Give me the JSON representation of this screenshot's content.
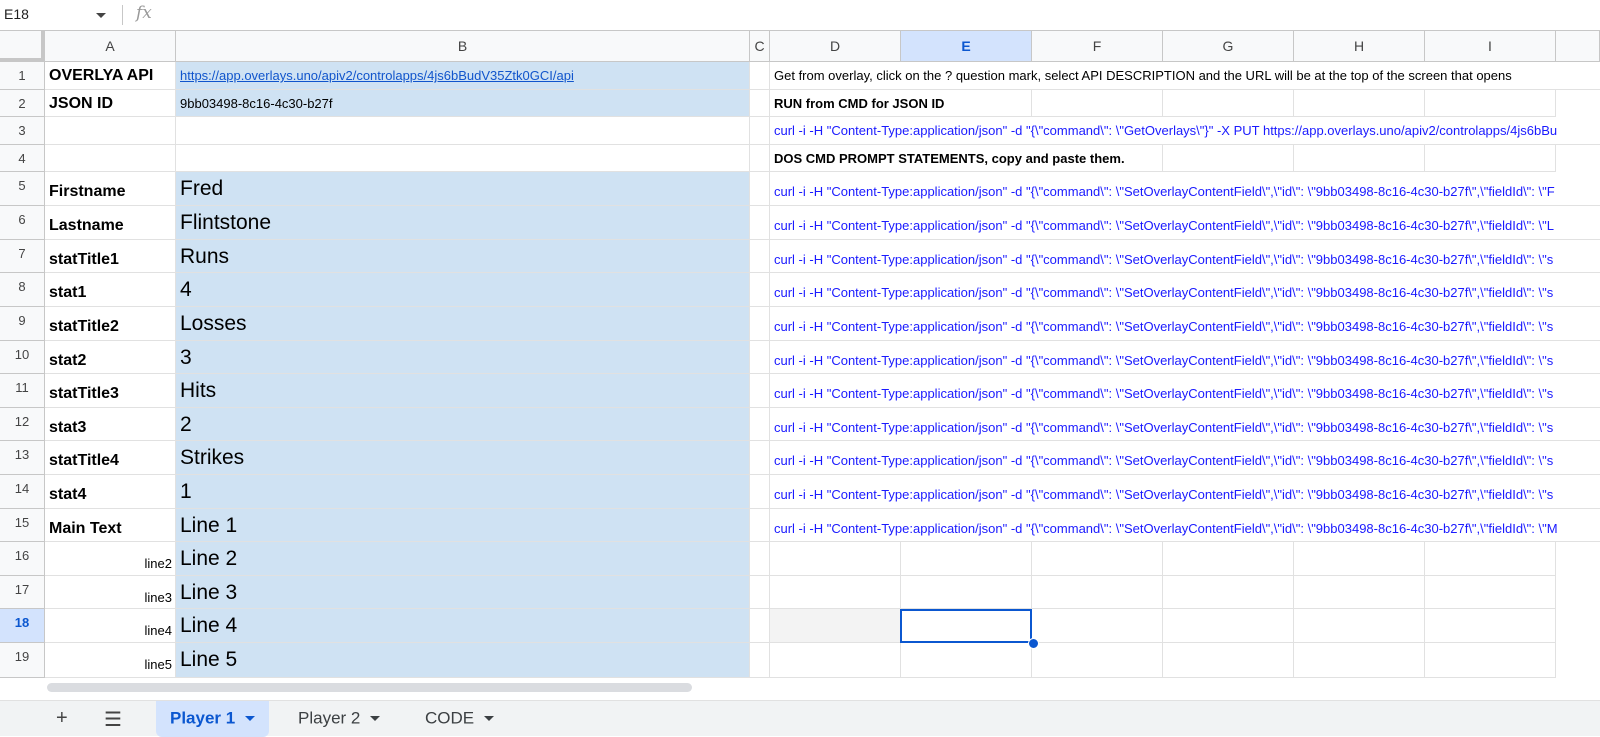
{
  "namebox": {
    "value": "E18"
  },
  "formula": {
    "fx_label": "fx"
  },
  "columns": [
    "A",
    "B",
    "C",
    "D",
    "E",
    "F",
    "G",
    "H",
    "I"
  ],
  "selected_column": "E",
  "rows": [
    "1",
    "2",
    "3",
    "4",
    "5",
    "6",
    "7",
    "8",
    "9",
    "10",
    "11",
    "12",
    "13",
    "14",
    "15",
    "16",
    "17",
    "18",
    "19"
  ],
  "selected_row": "18",
  "cells": {
    "a1": "OVERLYA API",
    "b1": "https://app.overlays.uno/apiv2/controlapps/4js6bBudV35Ztk0GCI/api",
    "a2": "JSON ID",
    "b2": "9bb03498-8c16-4c30-b27f",
    "a5": "Firstname",
    "b5": "Fred",
    "a6": "Lastname",
    "b6": "Flintstone",
    "a7": "statTitle1",
    "b7": "Runs",
    "a8": "stat1",
    "b8": "4",
    "a9": "statTitle2",
    "b9": "Losses",
    "a10": "stat2",
    "b10": "3",
    "a11": "statTitle3",
    "b11": "Hits",
    "a12": "stat3",
    "b12": "2",
    "a13": "statTitle4",
    "b13": "Strikes",
    "a14": "stat4",
    "b14": "1",
    "a15": "Main Text",
    "b15": "Line 1",
    "a16": "line2",
    "b16": "Line 2",
    "a17": "line3",
    "b17": "Line 3",
    "a18": "line4",
    "b18": "Line 4",
    "a19": "line5",
    "b19": "Line 5",
    "d1": "Get from overlay, click on the ? question mark, select API DESCRIPTION and the URL will be at the top of the screen that opens",
    "d2": "RUN from CMD for JSON ID",
    "d3": "curl -i -H \"Content-Type:application/json\" -d \"{\\\"command\\\": \\\"GetOverlays\\\"}\" -X PUT https://app.overlays.uno/apiv2/controlapps/4js6bBu",
    "d4": "DOS CMD PROMPT STATEMENTS, copy and paste them.",
    "d5": "curl -i -H \"Content-Type:application/json\" -d \"{\\\"command\\\": \\\"SetOverlayContentField\\\",\\\"id\\\": \\\"9bb03498-8c16-4c30-b27f\\\",\\\"fieldId\\\": \\\"F",
    "d6": "curl -i -H \"Content-Type:application/json\" -d \"{\\\"command\\\": \\\"SetOverlayContentField\\\",\\\"id\\\": \\\"9bb03498-8c16-4c30-b27f\\\",\\\"fieldId\\\": \\\"L",
    "d7": "curl -i -H \"Content-Type:application/json\" -d \"{\\\"command\\\": \\\"SetOverlayContentField\\\",\\\"id\\\": \\\"9bb03498-8c16-4c30-b27f\\\",\\\"fieldId\\\": \\\"s",
    "d8": "curl -i -H \"Content-Type:application/json\" -d \"{\\\"command\\\": \\\"SetOverlayContentField\\\",\\\"id\\\": \\\"9bb03498-8c16-4c30-b27f\\\",\\\"fieldId\\\": \\\"s",
    "d9": "curl -i -H \"Content-Type:application/json\" -d \"{\\\"command\\\": \\\"SetOverlayContentField\\\",\\\"id\\\": \\\"9bb03498-8c16-4c30-b27f\\\",\\\"fieldId\\\": \\\"s",
    "d10": "curl -i -H \"Content-Type:application/json\" -d \"{\\\"command\\\": \\\"SetOverlayContentField\\\",\\\"id\\\": \\\"9bb03498-8c16-4c30-b27f\\\",\\\"fieldId\\\": \\\"s",
    "d11": "curl -i -H \"Content-Type:application/json\" -d \"{\\\"command\\\": \\\"SetOverlayContentField\\\",\\\"id\\\": \\\"9bb03498-8c16-4c30-b27f\\\",\\\"fieldId\\\": \\\"s",
    "d12": "curl -i -H \"Content-Type:application/json\" -d \"{\\\"command\\\": \\\"SetOverlayContentField\\\",\\\"id\\\": \\\"9bb03498-8c16-4c30-b27f\\\",\\\"fieldId\\\": \\\"s",
    "d13": "curl -i -H \"Content-Type:application/json\" -d \"{\\\"command\\\": \\\"SetOverlayContentField\\\",\\\"id\\\": \\\"9bb03498-8c16-4c30-b27f\\\",\\\"fieldId\\\": \\\"s",
    "d14": "curl -i -H \"Content-Type:application/json\" -d \"{\\\"command\\\": \\\"SetOverlayContentField\\\",\\\"id\\\": \\\"9bb03498-8c16-4c30-b27f\\\",\\\"fieldId\\\": \\\"s",
    "d15": "curl -i -H \"Content-Type:application/json\" -d \"{\\\"command\\\": \\\"SetOverlayContentField\\\",\\\"id\\\": \\\"9bb03498-8c16-4c30-b27f\\\",\\\"fieldId\\\": \\\"M"
  },
  "tabs": [
    {
      "label": "Player 1",
      "active": true
    },
    {
      "label": "Player 2",
      "active": false
    },
    {
      "label": "CODE",
      "active": false
    }
  ],
  "colors": {
    "selection": "#0b57d0",
    "fill_blue": "#cfe2f3",
    "link": "#1155cc",
    "curl_text": "#1a1aff"
  }
}
